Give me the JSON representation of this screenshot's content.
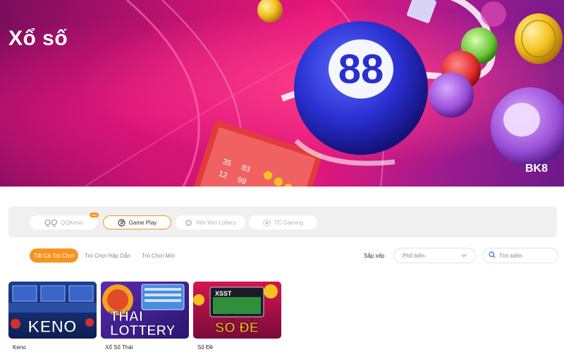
{
  "hero": {
    "title": "Xổ số",
    "ball_number": "88",
    "brand_logo": "BK8",
    "ticket_numbers": [
      "35",
      "83",
      "12",
      "99"
    ]
  },
  "providers": [
    {
      "label": "QQKeno",
      "logo_text": "QQ",
      "badge": "Hot",
      "active": false
    },
    {
      "label": "Game Play",
      "icon": "gameplay-icon",
      "active": true
    },
    {
      "label": "Win Win Lottery",
      "icon": "winwin-icon",
      "active": false
    },
    {
      "label": "TC Gaming",
      "icon": "tcgaming-icon",
      "active": false
    }
  ],
  "filters": {
    "tabs": [
      {
        "label": "Tất Cả Trò Chơi",
        "active": true
      },
      {
        "label": "Trò Chơi Hấp Dẫn",
        "active": false
      },
      {
        "label": "Trò Chơi Mới",
        "active": false
      }
    ],
    "sort_label": "Sắp xếp",
    "sort_value": "Phổ biến",
    "search_placeholder": "Tìm kiếm"
  },
  "games": [
    {
      "name": "Keno",
      "thumb_text": "KENO"
    },
    {
      "name": "Xổ Số Thái",
      "thumb_text_line1": "THAI",
      "thumb_text_line2": "LOTTERY"
    },
    {
      "name": "Số Đề",
      "thumb_text": "SỐ ĐỀ",
      "screen_text": "XSST"
    }
  ],
  "colors": {
    "accent": "#f7931e",
    "hero_pink": "#e8177a",
    "hero_purple": "#6c1a8a",
    "ball_blue": "#2a2fd0"
  }
}
